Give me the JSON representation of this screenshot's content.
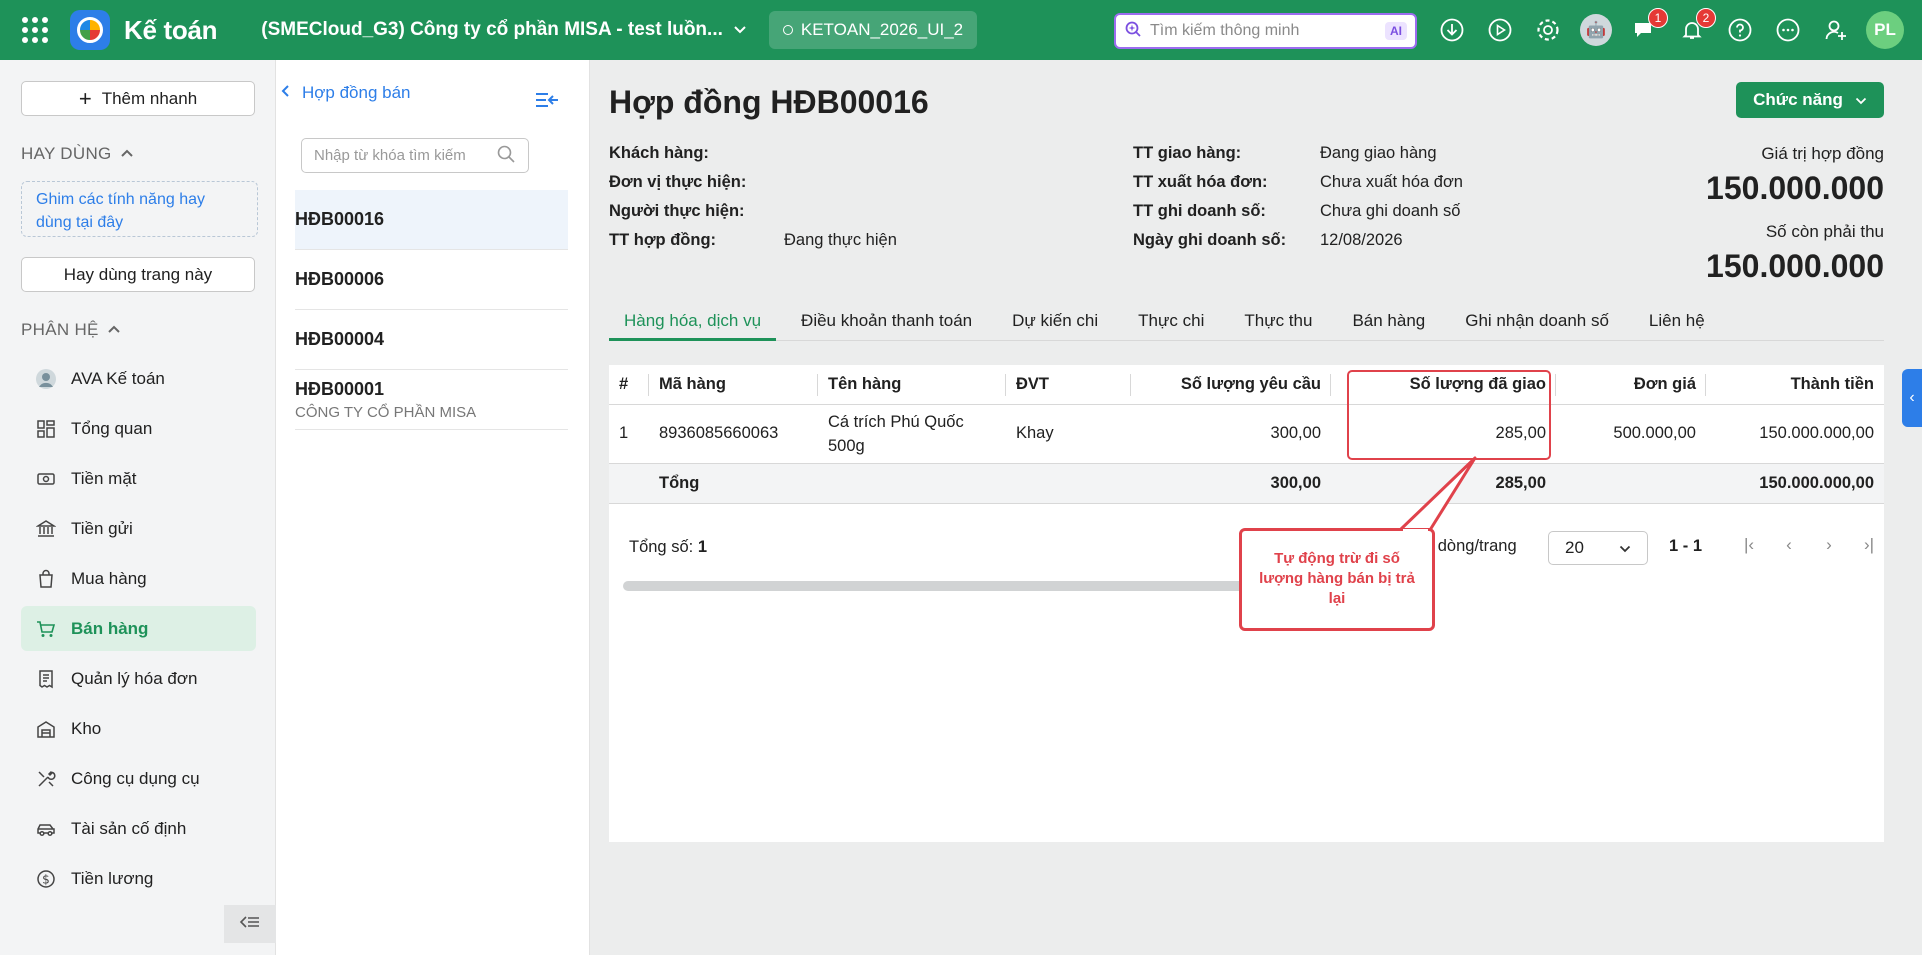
{
  "topbar": {
    "app_title": "Kế toán",
    "company": "(SMECloud_G3) Công ty cổ phần MISA - test luồn...",
    "database": "KETOAN_2026_UI_2",
    "search_placeholder": "Tìm kiếm thông minh",
    "search_ai": "AI",
    "chat_badge": "1",
    "notif_badge": "2",
    "user_initials": "PL"
  },
  "sidebar": {
    "quick_add": "Thêm nhanh",
    "frequent_header": "HAY DÙNG",
    "pin_hint": "Ghim các tính năng hay dùng tại đây",
    "use_page_button": "Hay dùng trang này",
    "modules_header": "PHÂN HỆ",
    "items": [
      {
        "label": "AVA Kế toán",
        "icon": "ava-avatar-icon"
      },
      {
        "label": "Tổng quan",
        "icon": "dashboard-icon"
      },
      {
        "label": "Tiền mặt",
        "icon": "cash-icon"
      },
      {
        "label": "Tiền gửi",
        "icon": "bank-icon"
      },
      {
        "label": "Mua hàng",
        "icon": "shopping-bag-icon"
      },
      {
        "label": "Bán hàng",
        "icon": "cart-icon",
        "active": true
      },
      {
        "label": "Quản lý hóa đơn",
        "icon": "invoice-icon"
      },
      {
        "label": "Kho",
        "icon": "warehouse-icon"
      },
      {
        "label": "Công cụ dụng cụ",
        "icon": "tools-icon"
      },
      {
        "label": "Tài sản cố định",
        "icon": "car-icon"
      },
      {
        "label": "Tiền lương",
        "icon": "salary-icon"
      }
    ]
  },
  "list_panel": {
    "back_label": "Hợp đồng bán",
    "search_placeholder": "Nhập từ khóa tìm kiếm",
    "items": [
      {
        "code": "HĐB00016",
        "sub": ""
      },
      {
        "code": "HĐB00006",
        "sub": ""
      },
      {
        "code": "HĐB00004",
        "sub": ""
      },
      {
        "code": "HĐB00001",
        "sub": "CÔNG TY CỔ PHẦN MISA"
      }
    ]
  },
  "main": {
    "title": "Hợp đồng HĐB00016",
    "function_button": "Chức năng",
    "fields_left": [
      {
        "label": "Khách hàng:",
        "value": ""
      },
      {
        "label": "Đơn vị thực hiện:",
        "value": ""
      },
      {
        "label": "Người thực hiện:",
        "value": ""
      },
      {
        "label": "TT hợp đồng:",
        "value": "Đang thực hiện"
      }
    ],
    "fields_right": [
      {
        "label": "TT giao hàng:",
        "value": "Đang giao hàng"
      },
      {
        "label": "TT xuất hóa đơn:",
        "value": "Chưa xuất hóa đơn"
      },
      {
        "label": "TT ghi doanh số:",
        "value": "Chưa ghi doanh số"
      },
      {
        "label": "Ngày ghi doanh số:",
        "value": "12/08/2026"
      }
    ],
    "contract_value_label": "Giá trị hợp đồng",
    "contract_value": "150.000.000",
    "remaining_label": "Số còn phải thu",
    "remaining_value": "150.000.000",
    "tabs": [
      "Hàng hóa, dịch vụ",
      "Điều khoản thanh toán",
      "Dự kiến chi",
      "Thực chi",
      "Thực thu",
      "Bán hàng",
      "Ghi nhận doanh số",
      "Liên hệ"
    ],
    "table": {
      "headers": [
        "#",
        "Mã hàng",
        "Tên hàng",
        "ĐVT",
        "Số lượng yêu cầu",
        "Số lượng đã giao",
        "Đơn giá",
        "Thành tiền"
      ],
      "rows": [
        [
          "1",
          "8936085660063",
          "Cá trích Phú Quốc 500g",
          "Khay",
          "300,00",
          "285,00",
          "500.000,00",
          "150.000.000,00"
        ]
      ],
      "total": {
        "label": "Tổng",
        "requested": "300,00",
        "delivered": "285,00",
        "amount": "150.000.000,00"
      }
    },
    "footer": {
      "total_label": "Tổng số:",
      "total_count": "1",
      "rows_per_page_label": "ố dòng/trang",
      "rows_per_page": "20",
      "range": "1 - 1"
    },
    "callout": "Tự động trừ đi số lượng hàng bán bị trả lại"
  },
  "colors": {
    "brand_green": "#1e9259",
    "link_blue": "#2d7ee8",
    "annotation_red": "#e0424b"
  }
}
